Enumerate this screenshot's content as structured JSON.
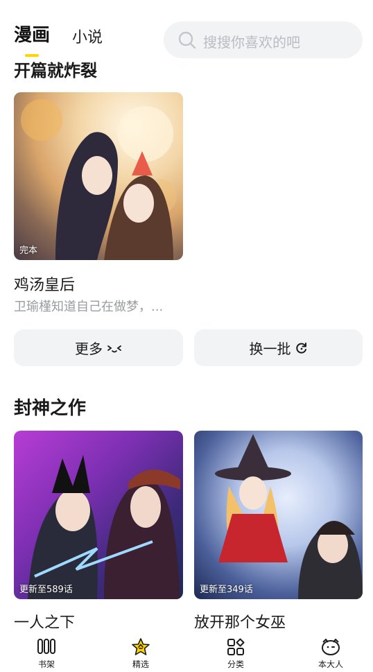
{
  "header": {
    "tabs": [
      {
        "label": "漫画",
        "active": true
      },
      {
        "label": "小说",
        "active": false
      }
    ],
    "search": {
      "placeholder": "搜搜你喜欢的吧"
    }
  },
  "sections": [
    {
      "title": "开篇就炸裂",
      "books": [
        {
          "title": "鸡汤皇后",
          "desc": "卫瑜槿知道自己在做梦，...",
          "badge": "完本"
        }
      ],
      "actions": {
        "more": "更多",
        "refresh": "换一批"
      }
    },
    {
      "title": "封神之作",
      "books": [
        {
          "title": "一人之下",
          "badge": "更新至589话"
        },
        {
          "title": "放开那个女巫",
          "badge": "更新至349话"
        }
      ]
    }
  ],
  "bottom_nav": [
    {
      "label": "书架",
      "icon": "bookshelf-icon"
    },
    {
      "label": "精选",
      "icon": "featured-star-icon",
      "active": true
    },
    {
      "label": "分类",
      "icon": "category-grid-icon"
    },
    {
      "label": "本大人",
      "icon": "profile-face-icon"
    }
  ],
  "colors": {
    "accent": "#ffd400",
    "pill_bg": "#f2f3f5",
    "muted_text": "#9a9ca2"
  }
}
